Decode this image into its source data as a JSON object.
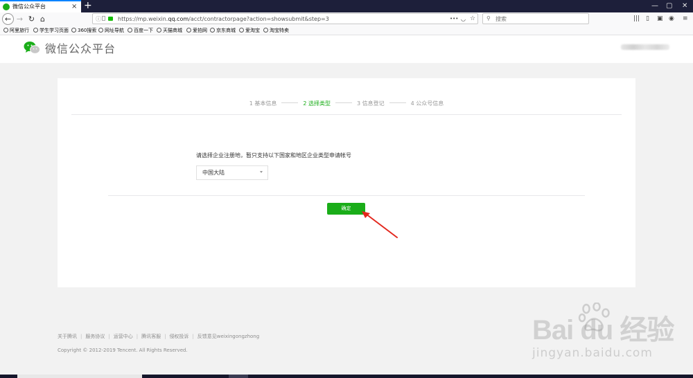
{
  "browser": {
    "tab_title": "微信公众平台",
    "tab_close": "×",
    "new_tab": "+",
    "window_controls": [
      "—",
      "▢",
      "✕"
    ],
    "url_prefix": "https://mp.weixin.",
    "url_domain": "qq.com",
    "url_path": "/acct/contractorpage?action=showsubmit&step=3",
    "url_menu": "•••",
    "search_placeholder": "搜索",
    "bookmarks": [
      "阿里旅行",
      "学生学习页面",
      "360搜索",
      "网址导航",
      "百度一下",
      "天猫商城",
      "爱拍网",
      "京东商城",
      "爱淘宝",
      "淘宝特卖"
    ]
  },
  "header": {
    "brand": "微信公众平台"
  },
  "steps": [
    {
      "label": "1 基本信息",
      "active": false
    },
    {
      "label": "2 选择类型",
      "active": true
    },
    {
      "label": "3 信息登记",
      "active": false
    },
    {
      "label": "4 公众号信息",
      "active": false
    }
  ],
  "form": {
    "prompt": "请选择企业注册地，暂只支持以下国家和地区企业类型申请帐号",
    "region_selected": "中国大陆",
    "confirm_label": "确定"
  },
  "footer": {
    "links": [
      "关于腾讯",
      "服务协议",
      "运营中心",
      "腾讯客服",
      "侵权投诉",
      "反馈意见weixingongzhong"
    ],
    "copyright": "Copyright © 2012-2019 Tencent. All Rights Reserved."
  },
  "watermark": {
    "brand": "Bai du 经验",
    "url": "jingyan.baidu.com"
  },
  "colors": {
    "accent": "#1aad19",
    "arrow": "#e3281e"
  }
}
